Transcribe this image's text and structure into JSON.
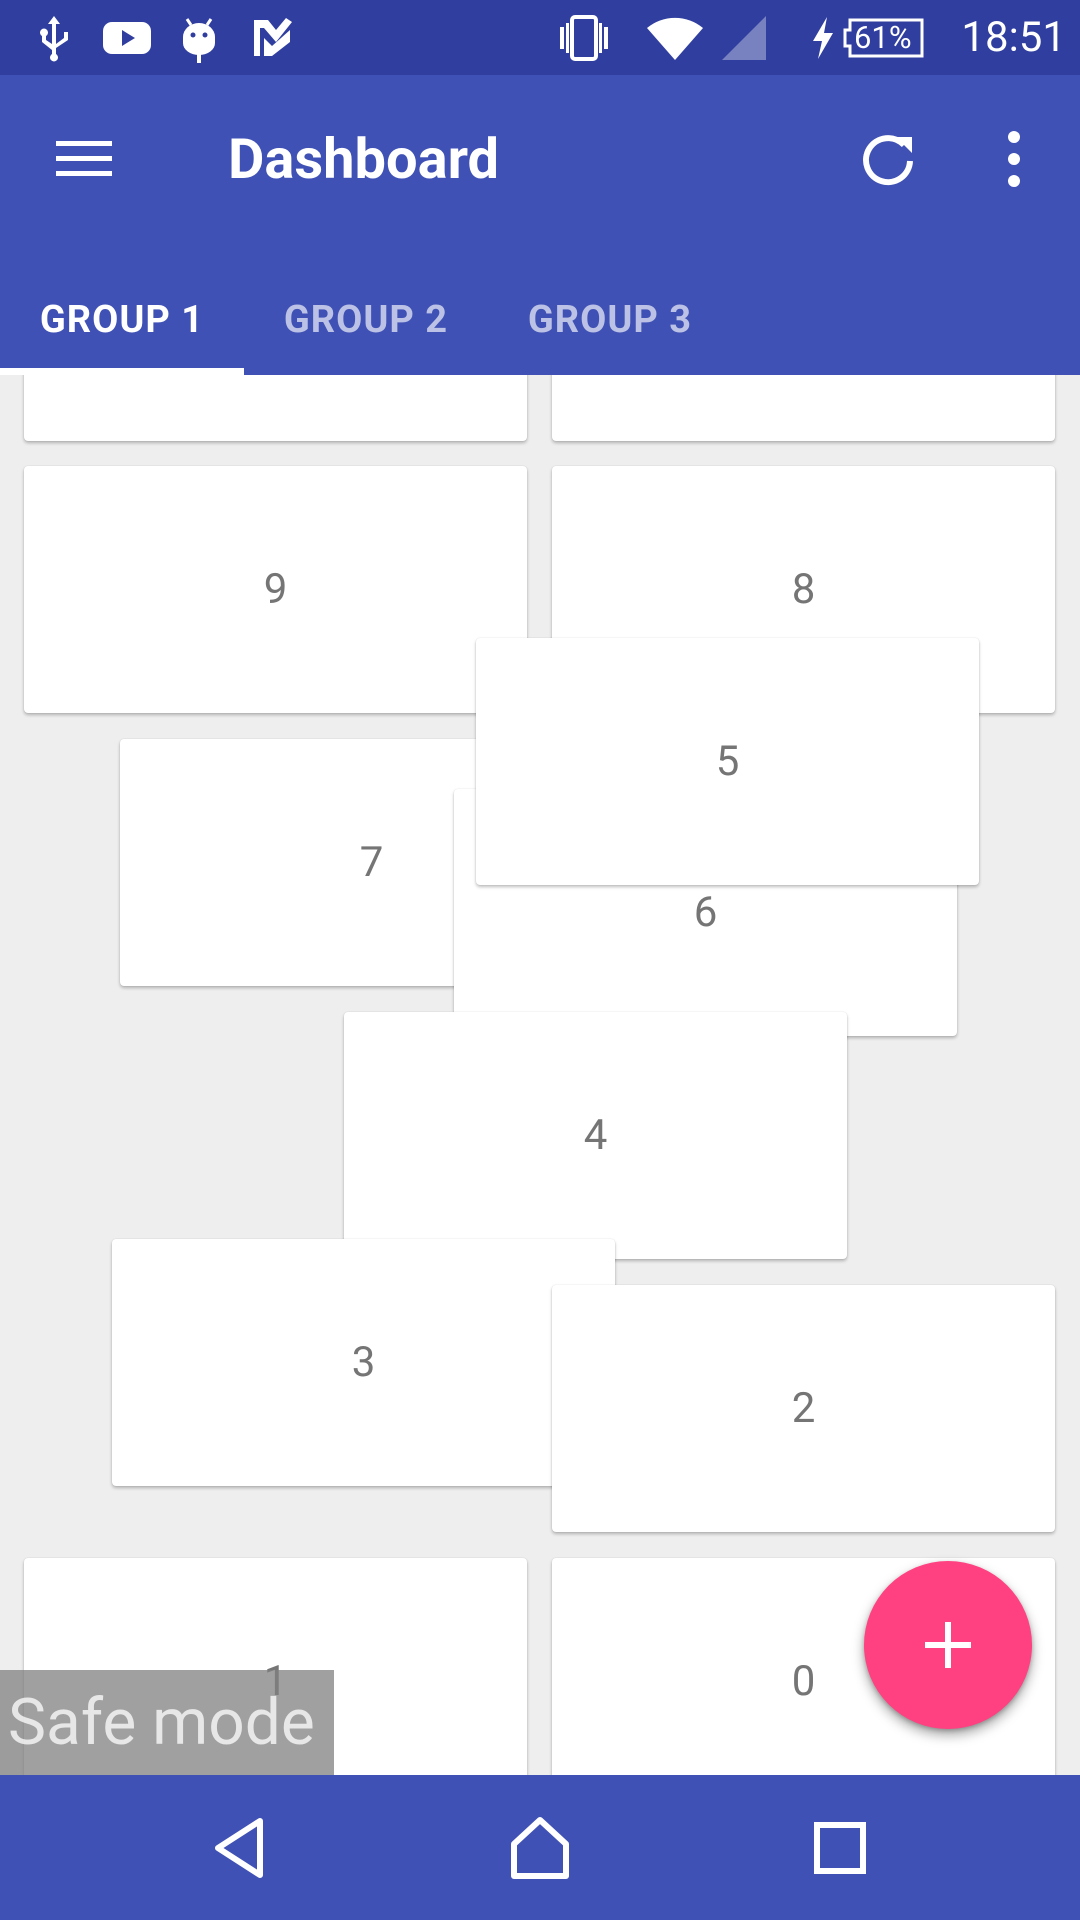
{
  "status_bar": {
    "time": "18:51",
    "battery": "61%",
    "left_icons": [
      "usb-icon",
      "youtube-icon",
      "android-debug-icon",
      "tasks-icon"
    ],
    "right_icons": [
      "vibrate-icon",
      "wifi-icon",
      "cell-signal-icon",
      "charging-icon",
      "battery-icon"
    ]
  },
  "app_bar": {
    "title": "Dashboard",
    "menu_icon": "hamburger-menu-icon",
    "refresh_icon": "refresh-icon",
    "overflow_icon": "more-vert-icon"
  },
  "tabs": [
    {
      "label": "GROUP 1",
      "selected": true
    },
    {
      "label": "GROUP 2",
      "selected": false
    },
    {
      "label": "GROUP 3",
      "selected": false
    }
  ],
  "cards": [
    {
      "label": ""
    },
    {
      "label": ""
    },
    {
      "label": "9"
    },
    {
      "label": "8"
    },
    {
      "label": "7"
    },
    {
      "label": "6"
    },
    {
      "label": "5"
    },
    {
      "label": "4"
    },
    {
      "label": "3"
    },
    {
      "label": "2"
    },
    {
      "label": "1"
    },
    {
      "label": "0"
    }
  ],
  "fab": {
    "icon": "add-icon"
  },
  "safe_mode": {
    "label": "Safe mode"
  },
  "nav_bar": {
    "back_icon": "back-icon",
    "home_icon": "home-icon",
    "recents_icon": "recents-icon"
  },
  "colors": {
    "primary": "#3f51b5",
    "primary_dark": "#303f9f",
    "accent": "#ff4081",
    "background": "#eeeeee"
  }
}
